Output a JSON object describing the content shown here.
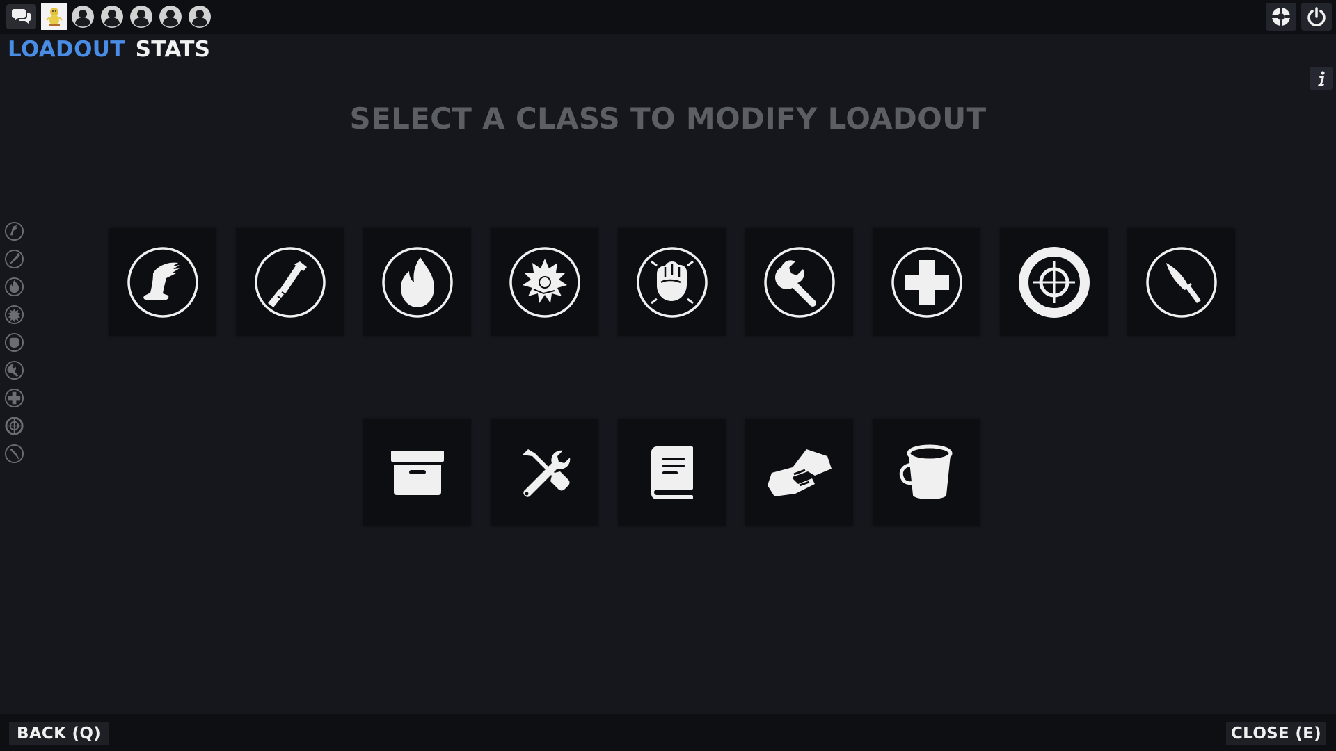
{
  "tabs": {
    "loadout": "LOADOUT",
    "stats": "STATS"
  },
  "heading": "SELECT A CLASS TO MODIFY LOADOUT",
  "footer": {
    "back": "BACK (Q)",
    "close": "CLOSE (E)"
  },
  "top_bar": {
    "left_icons": [
      "chat-icon",
      "user-avatar",
      "party-slot-icon",
      "party-slot-icon",
      "party-slot-icon",
      "party-slot-icon",
      "party-slot-icon"
    ],
    "right_icons": [
      "settings-icon",
      "power-icon"
    ]
  },
  "classes": [
    {
      "name": "scout",
      "icon": "scout-icon"
    },
    {
      "name": "soldier",
      "icon": "soldier-icon"
    },
    {
      "name": "pyro",
      "icon": "pyro-icon"
    },
    {
      "name": "demoman",
      "icon": "demoman-icon"
    },
    {
      "name": "heavy",
      "icon": "heavy-icon"
    },
    {
      "name": "engineer",
      "icon": "engineer-icon"
    },
    {
      "name": "medic",
      "icon": "medic-icon"
    },
    {
      "name": "sniper",
      "icon": "sniper-icon"
    },
    {
      "name": "spy",
      "icon": "spy-icon"
    }
  ],
  "utilities": [
    {
      "name": "backpack",
      "icon": "storage-box-icon"
    },
    {
      "name": "crafting",
      "icon": "crafting-tools-icon"
    },
    {
      "name": "catalog",
      "icon": "book-icon"
    },
    {
      "name": "trading",
      "icon": "handshake-icon"
    },
    {
      "name": "paint",
      "icon": "paint-bucket-icon"
    }
  ],
  "colors": {
    "background": "#15171c",
    "bar": "#0e0f12",
    "tile": "#0d0e11",
    "accent": "#4a8de6",
    "heading": "#5b5e63",
    "icon": "#f0f0f0"
  }
}
